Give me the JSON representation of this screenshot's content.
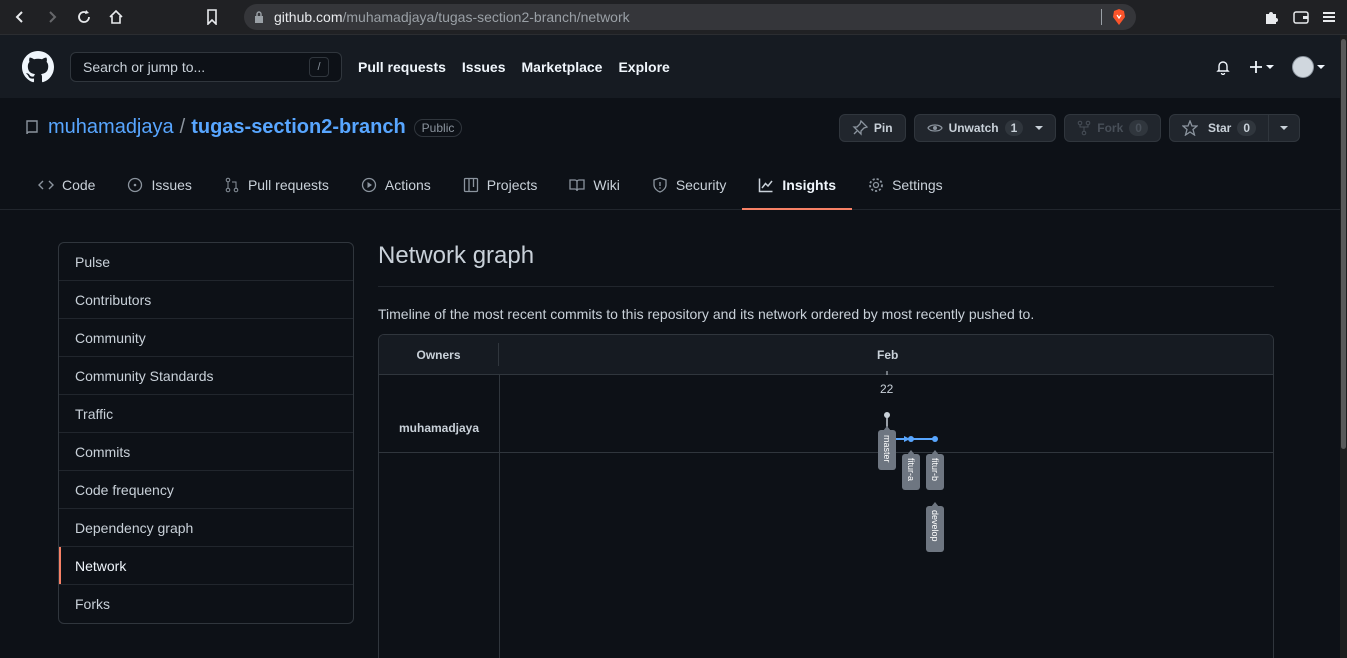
{
  "browser": {
    "url_host": "github.com",
    "url_path": "/muhamadjaya/tugas-section2-branch/network"
  },
  "header": {
    "search_placeholder": "Search or jump to...",
    "search_shortcut": "/",
    "nav": [
      "Pull requests",
      "Issues",
      "Marketplace",
      "Explore"
    ]
  },
  "repo": {
    "owner": "muhamadjaya",
    "separator": "/",
    "name": "tugas-section2-branch",
    "visibility": "Public",
    "pin_label": "Pin",
    "unwatch_label": "Unwatch",
    "unwatch_count": "1",
    "fork_label": "Fork",
    "fork_count": "0",
    "star_label": "Star",
    "star_count": "0"
  },
  "tabs": [
    {
      "label": "Code",
      "icon": "code-icon"
    },
    {
      "label": "Issues",
      "icon": "issue-icon"
    },
    {
      "label": "Pull requests",
      "icon": "pull-request-icon"
    },
    {
      "label": "Actions",
      "icon": "play-icon"
    },
    {
      "label": "Projects",
      "icon": "project-icon"
    },
    {
      "label": "Wiki",
      "icon": "book-icon"
    },
    {
      "label": "Security",
      "icon": "shield-icon"
    },
    {
      "label": "Insights",
      "icon": "graph-icon",
      "active": true
    },
    {
      "label": "Settings",
      "icon": "gear-icon"
    }
  ],
  "sidebar": {
    "items": [
      "Pulse",
      "Contributors",
      "Community",
      "Community Standards",
      "Traffic",
      "Commits",
      "Code frequency",
      "Dependency graph",
      "Network",
      "Forks"
    ],
    "selected": "Network"
  },
  "content": {
    "title": "Network graph",
    "description": "Timeline of the most recent commits to this repository and its network ordered by most recently pushed to.",
    "owners_header": "Owners",
    "month": "Feb",
    "day": "22",
    "owner": "muhamadjaya",
    "branches": [
      "master",
      "fitur-a",
      "fitur-b",
      "develop"
    ]
  },
  "colors": {
    "accent": "#f78166",
    "link": "#58a6ff",
    "branch_line": "#58a6ff"
  }
}
